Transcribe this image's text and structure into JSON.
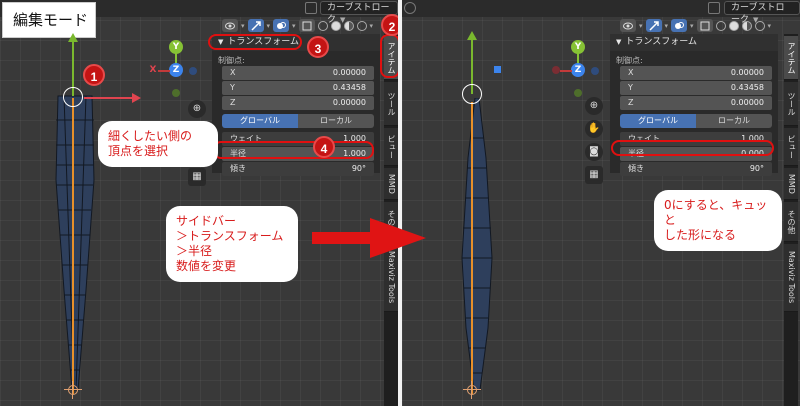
{
  "left": {
    "mode_label": "編集モード",
    "header": {
      "stroke_menu": "カーブストローク"
    },
    "panel": {
      "title": "トランスフォーム",
      "section": "制御点:",
      "rows": [
        {
          "key": "X",
          "value": "0.00000"
        },
        {
          "key": "Y",
          "value": "0.43458"
        },
        {
          "key": "Z",
          "value": "0.00000"
        }
      ],
      "seg_global": "グローバル",
      "seg_local": "ローカル",
      "weight": {
        "key": "ウェイト",
        "value": "1.000"
      },
      "radius": {
        "key": "半径",
        "value": "1.000"
      },
      "tilt": {
        "key": "傾き",
        "value": "90°"
      }
    },
    "tabs": [
      "アイテム",
      "ツール",
      "ビュー",
      "MMD",
      "その他",
      "Maxiviz Tools"
    ],
    "gizmo": {
      "y": "Y",
      "z": "Z",
      "x": "X"
    },
    "badges": [
      "1",
      "2",
      "3",
      "4"
    ],
    "bubble1": "細くしたい側の\n頂点を選択",
    "bubble2": "サイドバー\n＞トランスフォーム\n＞半径\n数値を変更"
  },
  "right": {
    "header": {
      "stroke_menu": "カーブストローク"
    },
    "panel": {
      "title": "トランスフォーム",
      "section": "制御点:",
      "rows": [
        {
          "key": "X",
          "value": "0.00000"
        },
        {
          "key": "Y",
          "value": "0.43458"
        },
        {
          "key": "Z",
          "value": "0.00000"
        }
      ],
      "seg_global": "グローバル",
      "seg_local": "ローカル",
      "weight": {
        "key": "ウェイト",
        "value": "1.000"
      },
      "radius": {
        "key": "半径",
        "value": "0.000"
      },
      "tilt": {
        "key": "傾き",
        "value": "90°"
      }
    },
    "tabs": [
      "アイテム",
      "ツール",
      "ビュー",
      "MMD",
      "その他",
      "Maxiviz Tools"
    ],
    "gizmo": {
      "y": "Y",
      "z": "Z"
    },
    "bubble3": "0にすると、キュッと\nした形になる"
  },
  "colors": {
    "accent": "#4772b3",
    "annotation": "#e01010",
    "y_axis": "#7ab82e",
    "x_axis": "#e0444f",
    "mesh": "#2e3f5c"
  },
  "icons": [
    "eye-icon",
    "cursor-icon",
    "overlay-icon",
    "wireframe-icon",
    "solid-sphere-icon",
    "material-sphere-icon",
    "rendered-sphere-icon",
    "zoom-icon",
    "hand-icon",
    "camera-icon",
    "grid-icon"
  ]
}
